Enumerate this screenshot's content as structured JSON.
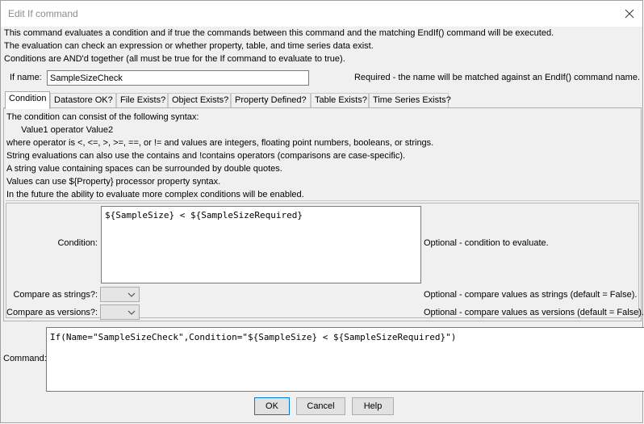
{
  "window": {
    "title": "Edit If command"
  },
  "description": [
    "This command evaluates a condition and if true the commands between this command and the matching EndIf() command will be executed.",
    "The evaluation can check an expression or whether property, table, and time series data exist.",
    "Conditions are AND'd together (all must be true for the If command to evaluate to true)."
  ],
  "if_name": {
    "label": "If name:",
    "value": "SampleSizeCheck",
    "note": "Required - the name will be matched against an EndIf() command name."
  },
  "tabs": [
    {
      "label": "Condition",
      "active": true
    },
    {
      "label": "Datastore OK?"
    },
    {
      "label": "File Exists?"
    },
    {
      "label": "Object Exists?"
    },
    {
      "label": "Property Defined?"
    },
    {
      "label": "Table Exists?"
    },
    {
      "label": "Time Series Exists?"
    }
  ],
  "condition_tab": {
    "help": [
      "The condition can consist of the following syntax:",
      "   Value1 operator Value2",
      "where operator is <, <=, >, >=, ==, or != and values are integers, floating point numbers, booleans, or strings.",
      "String evaluations can also use the contains and !contains operators (comparisons are case-specific).",
      "A string value containing spaces can be surrounded by double quotes.",
      "Values can use ${Property} processor property syntax.",
      "In the future the ability to evaluate more complex conditions will be enabled."
    ],
    "condition_label": "Condition:",
    "condition_value": "${SampleSize} < ${SampleSizeRequired}",
    "condition_note": "Optional - condition to evaluate.",
    "compare_strings_label": "Compare as strings?:",
    "compare_strings_value": "",
    "compare_strings_note": "Optional - compare values as strings (default = False).",
    "compare_versions_label": "Compare as versions?:",
    "compare_versions_value": "",
    "compare_versions_note": "Optional - compare values as versions (default = False)."
  },
  "command": {
    "label": "Command:",
    "value": "If(Name=\"SampleSizeCheck\",Condition=\"${SampleSize} < ${SampleSizeRequired}\")"
  },
  "buttons": {
    "ok": "OK",
    "cancel": "Cancel",
    "help": "Help"
  }
}
